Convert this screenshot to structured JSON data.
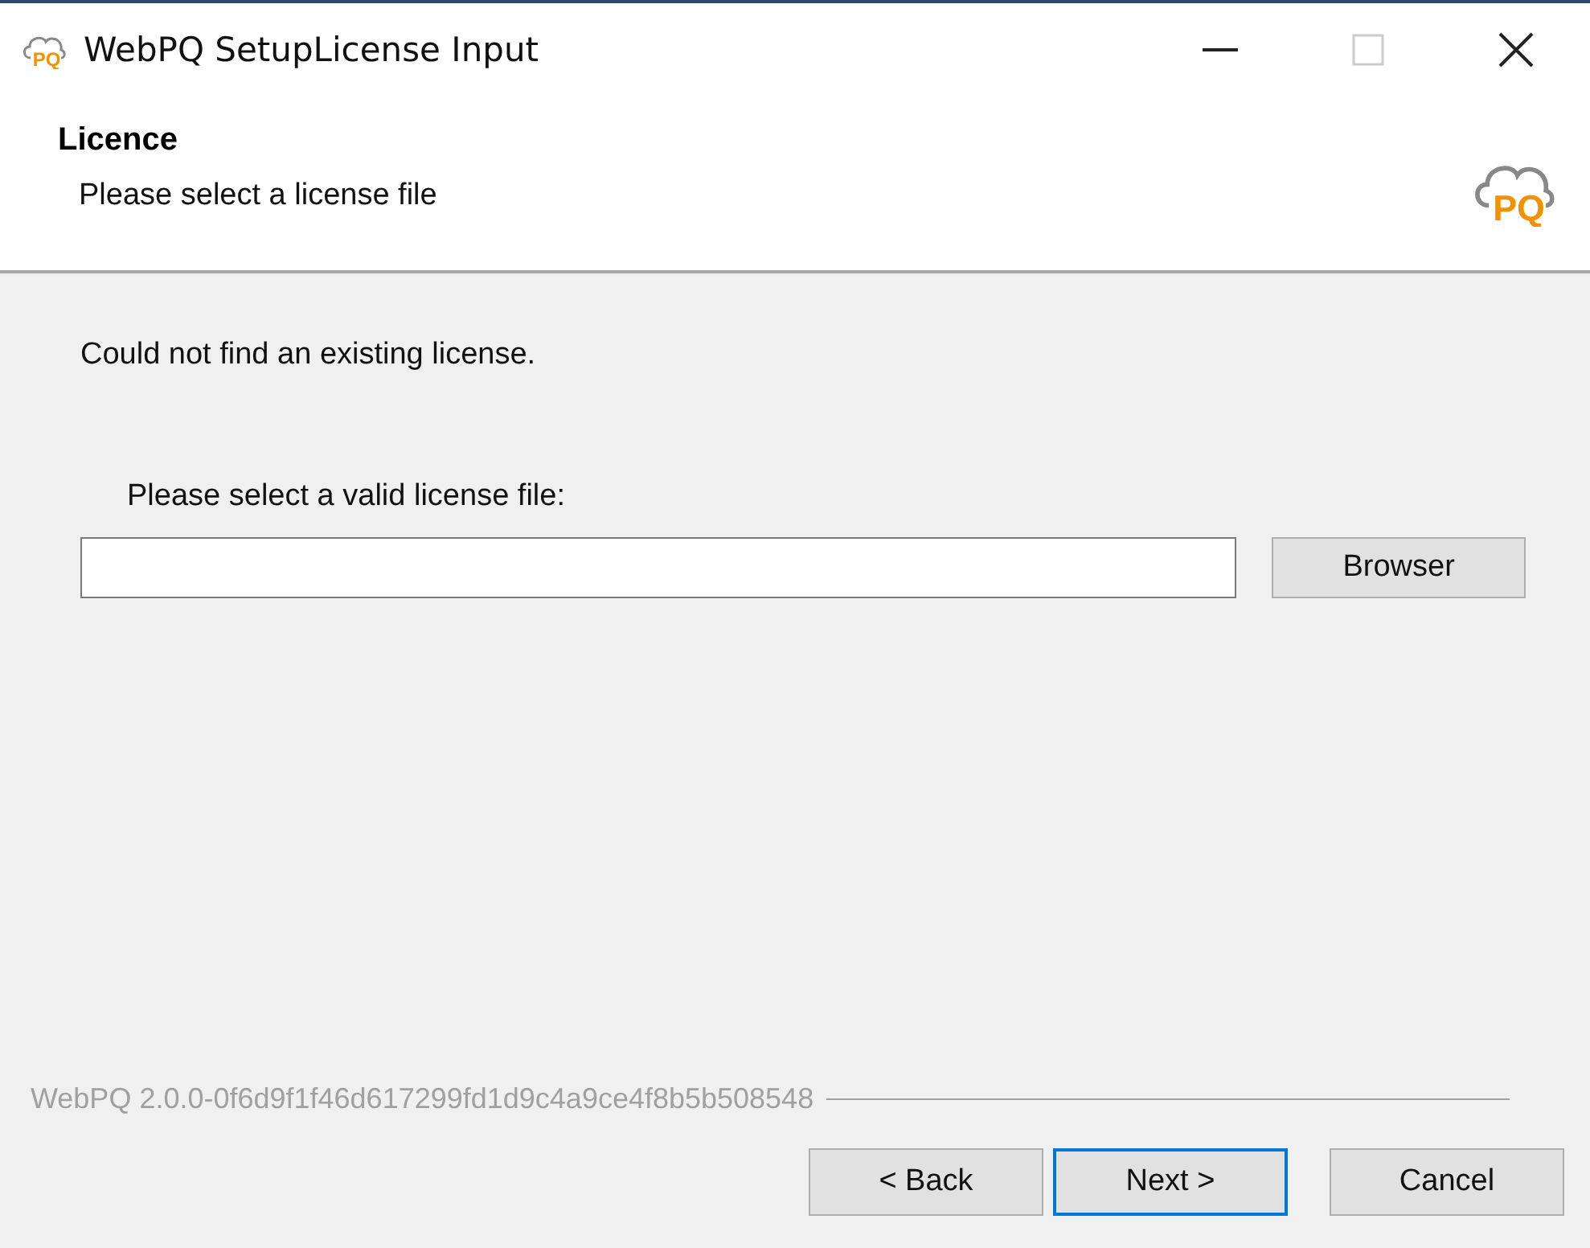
{
  "window": {
    "title": "WebPQ SetupLicense Input",
    "icon_text": "PQ",
    "controls": [
      {
        "kind": "minimize",
        "disabled": false
      },
      {
        "kind": "maximize",
        "disabled": true
      },
      {
        "kind": "close",
        "disabled": false
      }
    ]
  },
  "header": {
    "title": "Licence",
    "subtitle": "Please select a license file",
    "logo_text": "PQ"
  },
  "body": {
    "message": "Could not find an existing license.",
    "field_label": "Please select a valid license file:",
    "browse_button": "Browser"
  },
  "footer": {
    "version": "WebPQ 2.0.0-0f6d9f1f46d617299fd1d9c4a9ce4f8b5b508548",
    "buttons": [
      {
        "label": "< Back",
        "focused": false
      },
      {
        "label": "Next >",
        "focused": true
      },
      {
        "label": "Cancel",
        "focused": false
      }
    ]
  }
}
